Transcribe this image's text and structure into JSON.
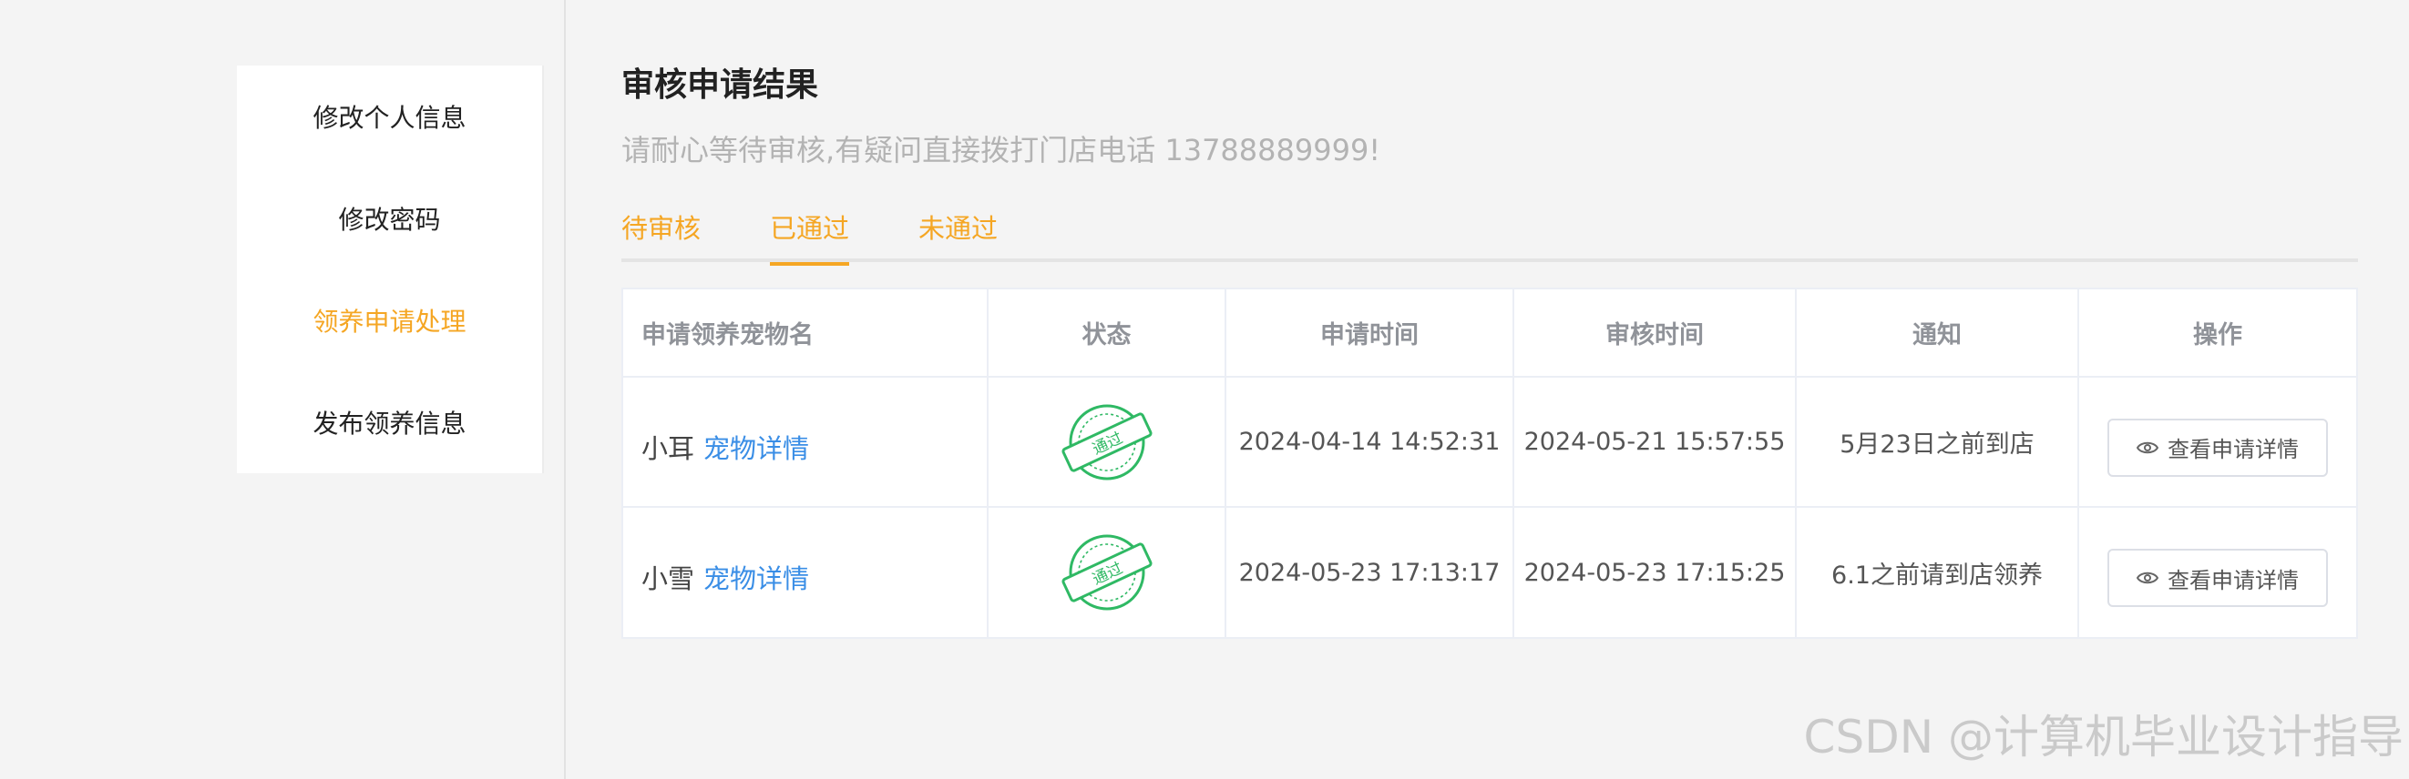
{
  "sidebar": {
    "items": [
      {
        "label": "修改个人信息"
      },
      {
        "label": "修改密码"
      },
      {
        "label": "领养申请处理"
      },
      {
        "label": "发布领养信息"
      }
    ]
  },
  "main": {
    "title": "审核申请结果",
    "subtitle": "请耐心等待审核,有疑问直接拨打门店电话 13788889999!",
    "tabs": [
      {
        "label": "待审核"
      },
      {
        "label": "已通过"
      },
      {
        "label": "未通过"
      }
    ]
  },
  "table": {
    "headers": [
      "申请领养宠物名",
      "状态",
      "申请时间",
      "审核时间",
      "通知",
      "操作"
    ],
    "rows": [
      {
        "pet_name": "小耳",
        "link": "宠物详情",
        "stamp": "通过",
        "apply_time": "2024-04-14 14:52:31",
        "review_time": "2024-05-21 15:57:55",
        "notice": "5月23日之前到店",
        "action": "查看申请详情"
      },
      {
        "pet_name": "小雪",
        "link": "宠物详情",
        "stamp": "通过",
        "apply_time": "2024-05-23 17:13:17",
        "review_time": "2024-05-23 17:15:25",
        "notice": "6.1之前请到店领养",
        "action": "查看申请详情"
      }
    ]
  },
  "colors": {
    "accent": "#f5a623",
    "link": "#3a8ee6",
    "stamp": "#2fb964"
  },
  "watermark": "CSDN @计算机毕业设计指导"
}
